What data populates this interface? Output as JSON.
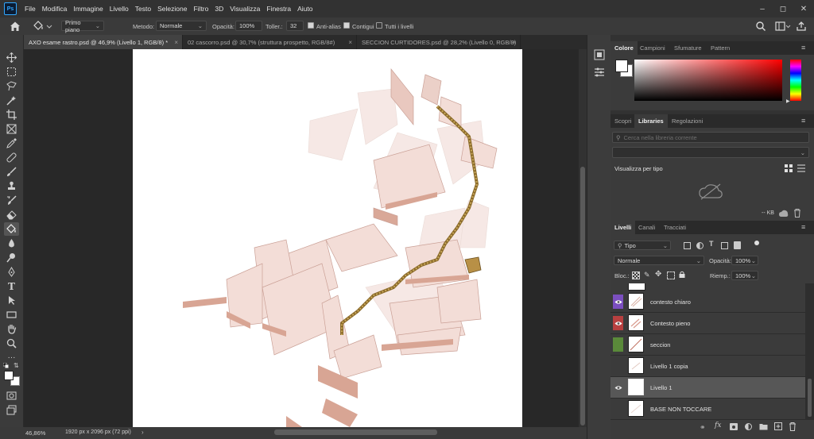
{
  "menubar": {
    "items": [
      "File",
      "Modifica",
      "Immagine",
      "Livello",
      "Testo",
      "Selezione",
      "Filtro",
      "3D",
      "Visualizza",
      "Finestra",
      "Aiuto"
    ],
    "logo": "Ps"
  },
  "options": {
    "fill_source": "Primo piano",
    "method_label": "Metodo:",
    "method_value": "Normale",
    "opacity_label": "Opacità:",
    "opacity_value": "100%",
    "tolerance_label": "Toller.:",
    "tolerance_value": "32",
    "antialias_label": "Anti-alias",
    "contiguous_label": "Contigui",
    "all_layers_label": "Tutti i livelli"
  },
  "tabs": [
    {
      "label": "AXO esame rastro.psd @ 46,9% (Livello 1, RGB/8) *"
    },
    {
      "label": "02 cascorro.psd @ 30,7% (struttura prospetto, RGB/8#)"
    },
    {
      "label": "SECCION CURTIDORES.psd @ 28,2% (Livello 0, RGB/8)"
    }
  ],
  "status": {
    "zoom": "46,86%",
    "doc_info": "1920 px x 2096 px (72 ppi)"
  },
  "color_panel": {
    "tabs": [
      "Colore",
      "Campioni",
      "Sfumature",
      "Pattern"
    ],
    "hue_color": "#ff0000"
  },
  "libraries_panel": {
    "tabs": [
      "Scopri",
      "Libraries",
      "Regolazioni"
    ],
    "search_placeholder": "Cerca nella libreria corrente",
    "view_label": "Visualizza per tipo",
    "size_label": "-- KB"
  },
  "layers_panel": {
    "tabs": [
      "Livelli",
      "Canali",
      "Tracciati"
    ],
    "filter_value": "Tipo",
    "blend_value": "Normale",
    "opacity_label": "Opacità:",
    "opacity_value": "100%",
    "lock_label": "Bloc.:",
    "fill_label": "Riemp.:",
    "fill_value": "100%",
    "layers": [
      {
        "name": "contesto chiaro",
        "tag_color": "#7b4fbf",
        "visible": true
      },
      {
        "name": "Contesto pieno",
        "tag_color": "#b84040",
        "visible": true
      },
      {
        "name": "seccion",
        "tag_color": "#5a8a3a",
        "visible": false
      },
      {
        "name": "Livello 1 copia",
        "tag_color": "",
        "visible": false
      },
      {
        "name": "Livello 1",
        "tag_color": "",
        "visible": true,
        "selected": true
      },
      {
        "name": "BASE NON TOCCARE",
        "tag_color": "",
        "visible": false
      }
    ]
  }
}
